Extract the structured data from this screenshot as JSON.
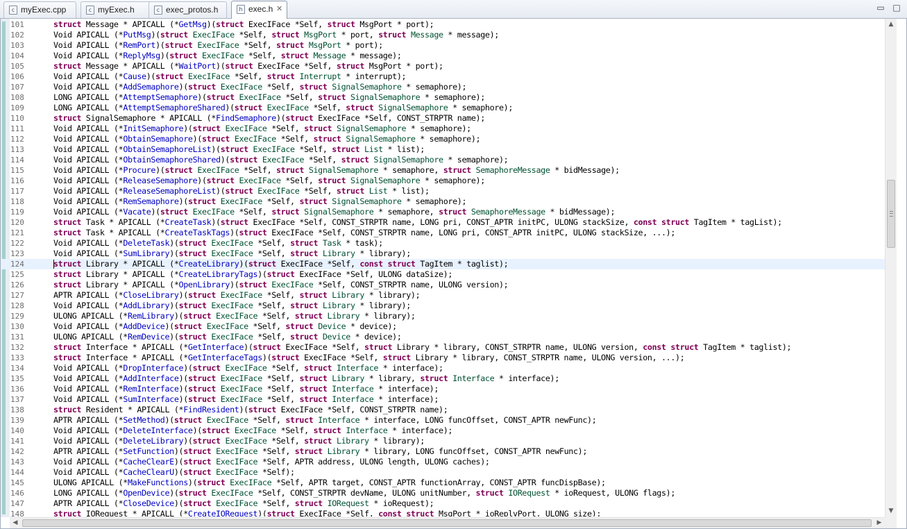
{
  "tabs": [
    {
      "label": "myExec.cpp",
      "icon": "cpp-source-file-icon",
      "icon_glyph": "c",
      "active": false
    },
    {
      "label": "myExec.h",
      "icon": "c-header-file-icon",
      "icon_glyph": "c",
      "active": false
    },
    {
      "label": "exec_protos.h",
      "icon": "c-header-file-icon",
      "icon_glyph": "c",
      "active": false
    },
    {
      "label": "exec.h",
      "icon": "c-header-file-icon",
      "icon_glyph": "h",
      "active": true,
      "close_glyph": "✕"
    }
  ],
  "window_controls": {
    "minimize_glyph": "▭",
    "maximize_glyph": "□"
  },
  "editor": {
    "current_line": 124,
    "lines": [
      {
        "n": "101",
        "text": "struct Message * APICALL (*GetMsg)(struct ExecIFace *Self, struct MsgPort * port);"
      },
      {
        "n": "102",
        "text": "Void APICALL (*PutMsg)(struct ExecIFace *Self, struct MsgPort * port, struct Message * message);"
      },
      {
        "n": "103",
        "text": "Void APICALL (*RemPort)(struct ExecIFace *Self, struct MsgPort * port);"
      },
      {
        "n": "104",
        "text": "Void APICALL (*ReplyMsg)(struct ExecIFace *Self, struct Message * message);"
      },
      {
        "n": "105",
        "text": "struct Message * APICALL (*WaitPort)(struct ExecIFace *Self, struct MsgPort * port);"
      },
      {
        "n": "106",
        "text": "Void APICALL (*Cause)(struct ExecIFace *Self, struct Interrupt * interrupt);"
      },
      {
        "n": "107",
        "text": "Void APICALL (*AddSemaphore)(struct ExecIFace *Self, struct SignalSemaphore * semaphore);"
      },
      {
        "n": "108",
        "text": "LONG APICALL (*AttemptSemaphore)(struct ExecIFace *Self, struct SignalSemaphore * semaphore);"
      },
      {
        "n": "109",
        "text": "LONG APICALL (*AttemptSemaphoreShared)(struct ExecIFace *Self, struct SignalSemaphore * semaphore);"
      },
      {
        "n": "110",
        "text": "struct SignalSemaphore * APICALL (*FindSemaphore)(struct ExecIFace *Self, CONST_STRPTR name);"
      },
      {
        "n": "111",
        "text": "Void APICALL (*InitSemaphore)(struct ExecIFace *Self, struct SignalSemaphore * semaphore);"
      },
      {
        "n": "112",
        "text": "Void APICALL (*ObtainSemaphore)(struct ExecIFace *Self, struct SignalSemaphore * semaphore);"
      },
      {
        "n": "113",
        "text": "Void APICALL (*ObtainSemaphoreList)(struct ExecIFace *Self, struct List * list);"
      },
      {
        "n": "114",
        "text": "Void APICALL (*ObtainSemaphoreShared)(struct ExecIFace *Self, struct SignalSemaphore * semaphore);"
      },
      {
        "n": "115",
        "text": "Void APICALL (*Procure)(struct ExecIFace *Self, struct SignalSemaphore * semaphore, struct SemaphoreMessage * bidMessage);"
      },
      {
        "n": "116",
        "text": "Void APICALL (*ReleaseSemaphore)(struct ExecIFace *Self, struct SignalSemaphore * semaphore);"
      },
      {
        "n": "117",
        "text": "Void APICALL (*ReleaseSemaphoreList)(struct ExecIFace *Self, struct List * list);"
      },
      {
        "n": "118",
        "text": "Void APICALL (*RemSemaphore)(struct ExecIFace *Self, struct SignalSemaphore * semaphore);"
      },
      {
        "n": "119",
        "text": "Void APICALL (*Vacate)(struct ExecIFace *Self, struct SignalSemaphore * semaphore, struct SemaphoreMessage * bidMessage);"
      },
      {
        "n": "120",
        "text": "struct Task * APICALL (*CreateTask)(struct ExecIFace *Self, CONST_STRPTR name, LONG pri, CONST_APTR initPC, ULONG stackSize, const struct TagItem * tagList);"
      },
      {
        "n": "121",
        "text": "struct Task * APICALL (*CreateTaskTags)(struct ExecIFace *Self, CONST_STRPTR name, LONG pri, CONST_APTR initPC, ULONG stackSize, ...);"
      },
      {
        "n": "122",
        "text": "Void APICALL (*DeleteTask)(struct ExecIFace *Self, struct Task * task);"
      },
      {
        "n": "123",
        "text": "Void APICALL (*SumLibrary)(struct ExecIFace *Self, struct Library * library);"
      },
      {
        "n": "124",
        "text": "struct Library * APICALL (*CreateLibrary)(struct ExecIFace *Self, const struct TagItem * taglist);"
      },
      {
        "n": "125",
        "text": "struct Library * APICALL (*CreateLibraryTags)(struct ExecIFace *Self, ULONG dataSize);"
      },
      {
        "n": "126",
        "text": "struct Library * APICALL (*OpenLibrary)(struct ExecIFace *Self, CONST_STRPTR name, ULONG version);"
      },
      {
        "n": "127",
        "text": "APTR APICALL (*CloseLibrary)(struct ExecIFace *Self, struct Library * library);"
      },
      {
        "n": "128",
        "text": "Void APICALL (*AddLibrary)(struct ExecIFace *Self, struct Library * library);"
      },
      {
        "n": "129",
        "text": "ULONG APICALL (*RemLibrary)(struct ExecIFace *Self, struct Library * library);"
      },
      {
        "n": "130",
        "text": "Void APICALL (*AddDevice)(struct ExecIFace *Self, struct Device * device);"
      },
      {
        "n": "131",
        "text": "ULONG APICALL (*RemDevice)(struct ExecIFace *Self, struct Device * device);"
      },
      {
        "n": "132",
        "text": "struct Interface * APICALL (*GetInterface)(struct ExecIFace *Self, struct Library * library, CONST_STRPTR name, ULONG version, const struct TagItem * taglist);"
      },
      {
        "n": "133",
        "text": "struct Interface * APICALL (*GetInterfaceTags)(struct ExecIFace *Self, struct Library * library, CONST_STRPTR name, ULONG version, ...);"
      },
      {
        "n": "134",
        "text": "Void APICALL (*DropInterface)(struct ExecIFace *Self, struct Interface * interface);"
      },
      {
        "n": "135",
        "text": "Void APICALL (*AddInterface)(struct ExecIFace *Self, struct Library * library, struct Interface * interface);"
      },
      {
        "n": "136",
        "text": "Void APICALL (*RemInterface)(struct ExecIFace *Self, struct Interface * interface);"
      },
      {
        "n": "137",
        "text": "Void APICALL (*SumInterface)(struct ExecIFace *Self, struct Interface * interface);"
      },
      {
        "n": "138",
        "text": "struct Resident * APICALL (*FindResident)(struct ExecIFace *Self, CONST_STRPTR name);"
      },
      {
        "n": "139",
        "text": "APTR APICALL (*SetMethod)(struct ExecIFace *Self, struct Interface * interface, LONG funcOffset, CONST_APTR newFunc);"
      },
      {
        "n": "140",
        "text": "Void APICALL (*DeleteInterface)(struct ExecIFace *Self, struct Interface * interface);"
      },
      {
        "n": "141",
        "text": "Void APICALL (*DeleteLibrary)(struct ExecIFace *Self, struct Library * library);"
      },
      {
        "n": "142",
        "text": "APTR APICALL (*SetFunction)(struct ExecIFace *Self, struct Library * library, LONG funcOffset, CONST_APTR newFunc);"
      },
      {
        "n": "143",
        "text": "Void APICALL (*CacheClearE)(struct ExecIFace *Self, APTR address, ULONG length, ULONG caches);"
      },
      {
        "n": "144",
        "text": "Void APICALL (*CacheClearU)(struct ExecIFace *Self);"
      },
      {
        "n": "145",
        "text": "ULONG APICALL (*MakeFunctions)(struct ExecIFace *Self, APTR target, CONST_APTR functionArray, CONST_APTR funcDispBase);"
      },
      {
        "n": "146",
        "text": "LONG APICALL (*OpenDevice)(struct ExecIFace *Self, CONST_STRPTR devName, ULONG unitNumber, struct IORequest * ioRequest, ULONG flags);"
      },
      {
        "n": "147",
        "text": "APTR APICALL (*CloseDevice)(struct ExecIFace *Self, struct IORequest * ioRequest);"
      },
      {
        "n": "148",
        "text": "struct IORequest * APICALL (*CreateIORequest)(struct ExecIFace *Self, const struct MsgPort * ioReplyPort, ULONG size);"
      }
    ]
  },
  "scrollbars": {
    "up_glyph": "▲",
    "down_glyph": "▼",
    "left_glyph": "◀",
    "right_glyph": "▶"
  },
  "colors": {
    "keyword": "#7f0055",
    "type": "#005032",
    "function_name": "#0000c0",
    "current_line": "#e8f2fe",
    "ruler_band": "#a2d0c9"
  }
}
